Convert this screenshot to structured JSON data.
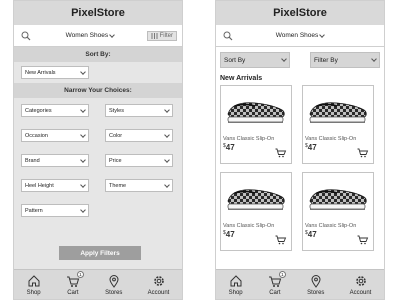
{
  "filter_screen": {
    "app_title": "PixelStore",
    "search": {
      "category": "Women Shoes",
      "filter_label": "Filter"
    },
    "sort_by_title": "Sort By:",
    "sort_value": "New Arrivals",
    "narrow_title": "Narrow Your Choices:",
    "filters": [
      "Categories",
      "Styles",
      "Occasion",
      "Color",
      "Brand",
      "Price",
      "Heel Height",
      "Theme",
      "Pattern"
    ],
    "apply_label": "Apply Filters"
  },
  "listing_screen": {
    "app_title": "PixelStore",
    "search": {
      "category": "Women Shoes"
    },
    "sort_label": "Sort By",
    "filter_label": "Filter By",
    "section_title": "New Arrivals",
    "products": [
      {
        "name": "Vans Classic Slip-On",
        "currency": "$",
        "price": "47"
      },
      {
        "name": "Vans Classic Slip-On",
        "currency": "$",
        "price": "47"
      },
      {
        "name": "Vans Classic Slip-On",
        "currency": "$",
        "price": "47"
      },
      {
        "name": "Vans Classic Slip-On",
        "currency": "$",
        "price": "47"
      }
    ]
  },
  "nav": {
    "items": [
      {
        "label": "Shop",
        "icon": "home-icon"
      },
      {
        "label": "Cart",
        "icon": "cart-icon",
        "badge": "1"
      },
      {
        "label": "Stores",
        "icon": "location-pin-icon"
      },
      {
        "label": "Account",
        "icon": "gear-icon"
      }
    ]
  },
  "colors": {
    "header": "#d9d9d9",
    "panel": "#e6e6e6",
    "apply_button": "#9e9e9e"
  }
}
